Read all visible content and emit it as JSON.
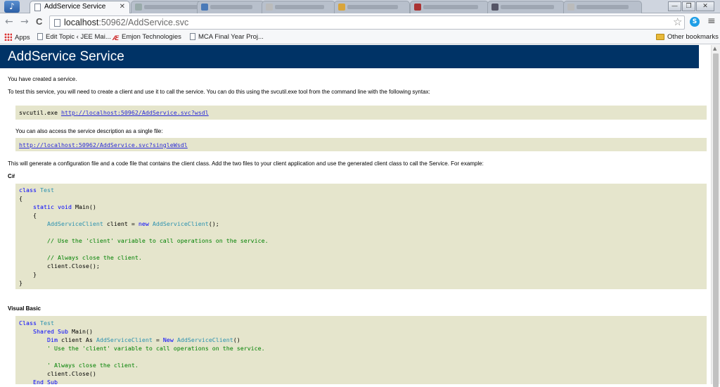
{
  "browser": {
    "tabs": [
      {
        "title": "AddService Service",
        "active": true
      }
    ],
    "url_host": "localhost",
    "url_rest": ":50962/AddService.svc",
    "bookmarks": [
      {
        "label": "Apps",
        "icon": "apps-icon"
      },
      {
        "label": "Edit Topic ‹ JEE Mai...",
        "icon": "page-icon"
      },
      {
        "label": "Emjon Technologies",
        "icon": "emjon-icon"
      },
      {
        "label": "MCA Final Year Proj...",
        "icon": "page-icon"
      }
    ],
    "other_bookmarks": "Other bookmarks",
    "tab_close": "✕",
    "nav": {
      "back": "←",
      "forward": "→",
      "reload": "C"
    },
    "controls": {
      "star": "☆",
      "skype": "S",
      "menu": "≡",
      "minimize": "—",
      "restore": "❐",
      "close": "✕"
    }
  },
  "page": {
    "heading": "AddService Service",
    "created": "You have created a service.",
    "instructions": "To test this service, you will need to create a client and use it to call the service. You can do this using the svcutil.exe tool from the command line with the following syntax:",
    "svcutil_cmd": "svcutil.exe ",
    "wsdl_url": "http://localhost:50962/AddService.svc?wsdl",
    "single_file_text": "You can also access the service description as a single file:",
    "single_wsdl_url": "http://localhost:50962/AddService.svc?singleWsdl",
    "generate_text": "This will generate a configuration file and a code file that contains the client class. Add the two files to your client application and use the generated client class to call the Service. For example:",
    "csharp_label": "C#",
    "vb_label": "Visual Basic",
    "csharp_code": [
      [
        [
          "kw",
          "class"
        ],
        [
          "t",
          " "
        ],
        [
          "ty",
          "Test"
        ]
      ],
      [
        [
          "t",
          "{"
        ]
      ],
      [
        [
          "t",
          "    "
        ],
        [
          "kw",
          "static"
        ],
        [
          "t",
          " "
        ],
        [
          "kw",
          "void"
        ],
        [
          "t",
          " Main()"
        ]
      ],
      [
        [
          "t",
          "    {"
        ]
      ],
      [
        [
          "t",
          "        "
        ],
        [
          "ty",
          "AddServiceClient"
        ],
        [
          "t",
          " client = "
        ],
        [
          "kw",
          "new"
        ],
        [
          "t",
          " "
        ],
        [
          "ty",
          "AddServiceClient"
        ],
        [
          "t",
          "();"
        ]
      ],
      [
        [
          "t",
          ""
        ]
      ],
      [
        [
          "t",
          "        "
        ],
        [
          "cm",
          "// Use the 'client' variable to call operations on the service."
        ]
      ],
      [
        [
          "t",
          ""
        ]
      ],
      [
        [
          "t",
          "        "
        ],
        [
          "cm",
          "// Always close the client."
        ]
      ],
      [
        [
          "t",
          "        client.Close();"
        ]
      ],
      [
        [
          "t",
          "    }"
        ]
      ],
      [
        [
          "t",
          "}"
        ]
      ]
    ],
    "vb_code": [
      [
        [
          "kw",
          "Class"
        ],
        [
          "t",
          " "
        ],
        [
          "ty",
          "Test"
        ]
      ],
      [
        [
          "t",
          "    "
        ],
        [
          "kw",
          "Shared"
        ],
        [
          "t",
          " "
        ],
        [
          "kw",
          "Sub"
        ],
        [
          "t",
          " Main()"
        ]
      ],
      [
        [
          "t",
          "        "
        ],
        [
          "kw",
          "Dim"
        ],
        [
          "t",
          " client As "
        ],
        [
          "ty",
          "AddServiceClient"
        ],
        [
          "t",
          " = "
        ],
        [
          "kw",
          "New"
        ],
        [
          "t",
          " "
        ],
        [
          "ty",
          "AddServiceClient"
        ],
        [
          "t",
          "()"
        ]
      ],
      [
        [
          "t",
          "        "
        ],
        [
          "cm",
          "' Use the 'client' variable to call operations on the service."
        ]
      ],
      [
        [
          "t",
          ""
        ]
      ],
      [
        [
          "t",
          "        "
        ],
        [
          "cm",
          "' Always close the client."
        ]
      ],
      [
        [
          "t",
          "        client.Close()"
        ]
      ],
      [
        [
          "t",
          "    "
        ],
        [
          "kw",
          "End"
        ],
        [
          "t",
          " "
        ],
        [
          "kw",
          "Sub"
        ]
      ]
    ]
  },
  "colors": {
    "header_bg": "#003366",
    "code_bg": "#e5e5cc",
    "keyword": "#0000ff",
    "type": "#2b91af",
    "comment": "#008000"
  }
}
